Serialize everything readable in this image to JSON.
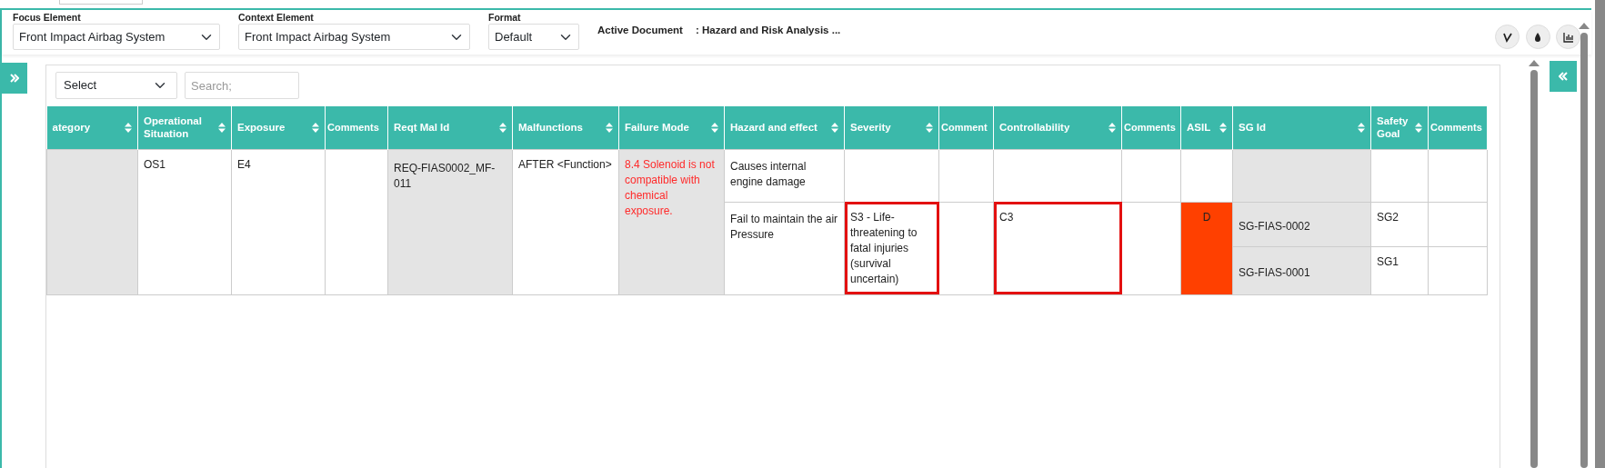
{
  "header": {
    "fields": [
      {
        "label": "Focus Element",
        "value": "Front Impact Airbag System"
      },
      {
        "label": "Context Element",
        "value": "Front Impact Airbag System"
      },
      {
        "label": "Format",
        "value": "Default"
      }
    ],
    "active_document": {
      "label": "Active Document",
      "value": ": Hazard and Risk Analysis ..."
    }
  },
  "toolbar": {
    "filter": {
      "value": "Select"
    },
    "search": {
      "placeholder": "Search;"
    }
  },
  "table": {
    "columns": [
      {
        "label": "ategory",
        "sortable": true,
        "shaded": true
      },
      {
        "label": "Operational Situation",
        "sortable": true,
        "shaded": false
      },
      {
        "label": "Exposure",
        "sortable": true,
        "shaded": false
      },
      {
        "label": "Comments",
        "sortable": false,
        "shaded": false
      },
      {
        "label": "Reqt Mal Id",
        "sortable": true,
        "shaded": true
      },
      {
        "label": "Malfunctions",
        "sortable": true,
        "shaded": false
      },
      {
        "label": "Failure Mode",
        "sortable": true,
        "shaded": true
      },
      {
        "label": "Hazard and effect",
        "sortable": true,
        "shaded": false
      },
      {
        "label": "Severity",
        "sortable": true,
        "shaded": false
      },
      {
        "label": "Comment",
        "sortable": false,
        "shaded": false
      },
      {
        "label": "Controllability",
        "sortable": true,
        "shaded": false
      },
      {
        "label": "Comments",
        "sortable": false,
        "shaded": false
      },
      {
        "label": "ASIL",
        "sortable": true,
        "shaded": false
      },
      {
        "label": "SG Id",
        "sortable": true,
        "shaded": true
      },
      {
        "label": "Safety Goal",
        "sortable": true,
        "shaded": false
      },
      {
        "label": "Comments",
        "sortable": false,
        "shaded": false
      }
    ],
    "rows": [
      {
        "operational_situation": "OS1",
        "exposure": "E4",
        "reqt_mal_id": "REQ-FIAS0002_MF-011",
        "malfunction": "AFTER <Function>",
        "failure_mode": "8.4 Solenoid is not compatible with chemical exposure.",
        "hazards": [
          {
            "hazard": "Causes internal engine damage",
            "severity_flagged": false,
            "controllability_flagged": false
          },
          {
            "hazard": "Fail to maintain the air Pressure",
            "severity": "S3 - Life-threatening to fatal injuries (survival uncertain)",
            "severity_flagged": true,
            "controllability": "C3",
            "controllability_flagged": true,
            "asil": {
              "level": "D",
              "color": "#ff4000"
            },
            "safety_goals": [
              {
                "sg_id": "SG-FIAS-0002",
                "safety_goal": "SG2"
              },
              {
                "sg_id": "SG-FIAS-0001",
                "safety_goal": "SG1"
              }
            ]
          }
        ]
      }
    ]
  }
}
